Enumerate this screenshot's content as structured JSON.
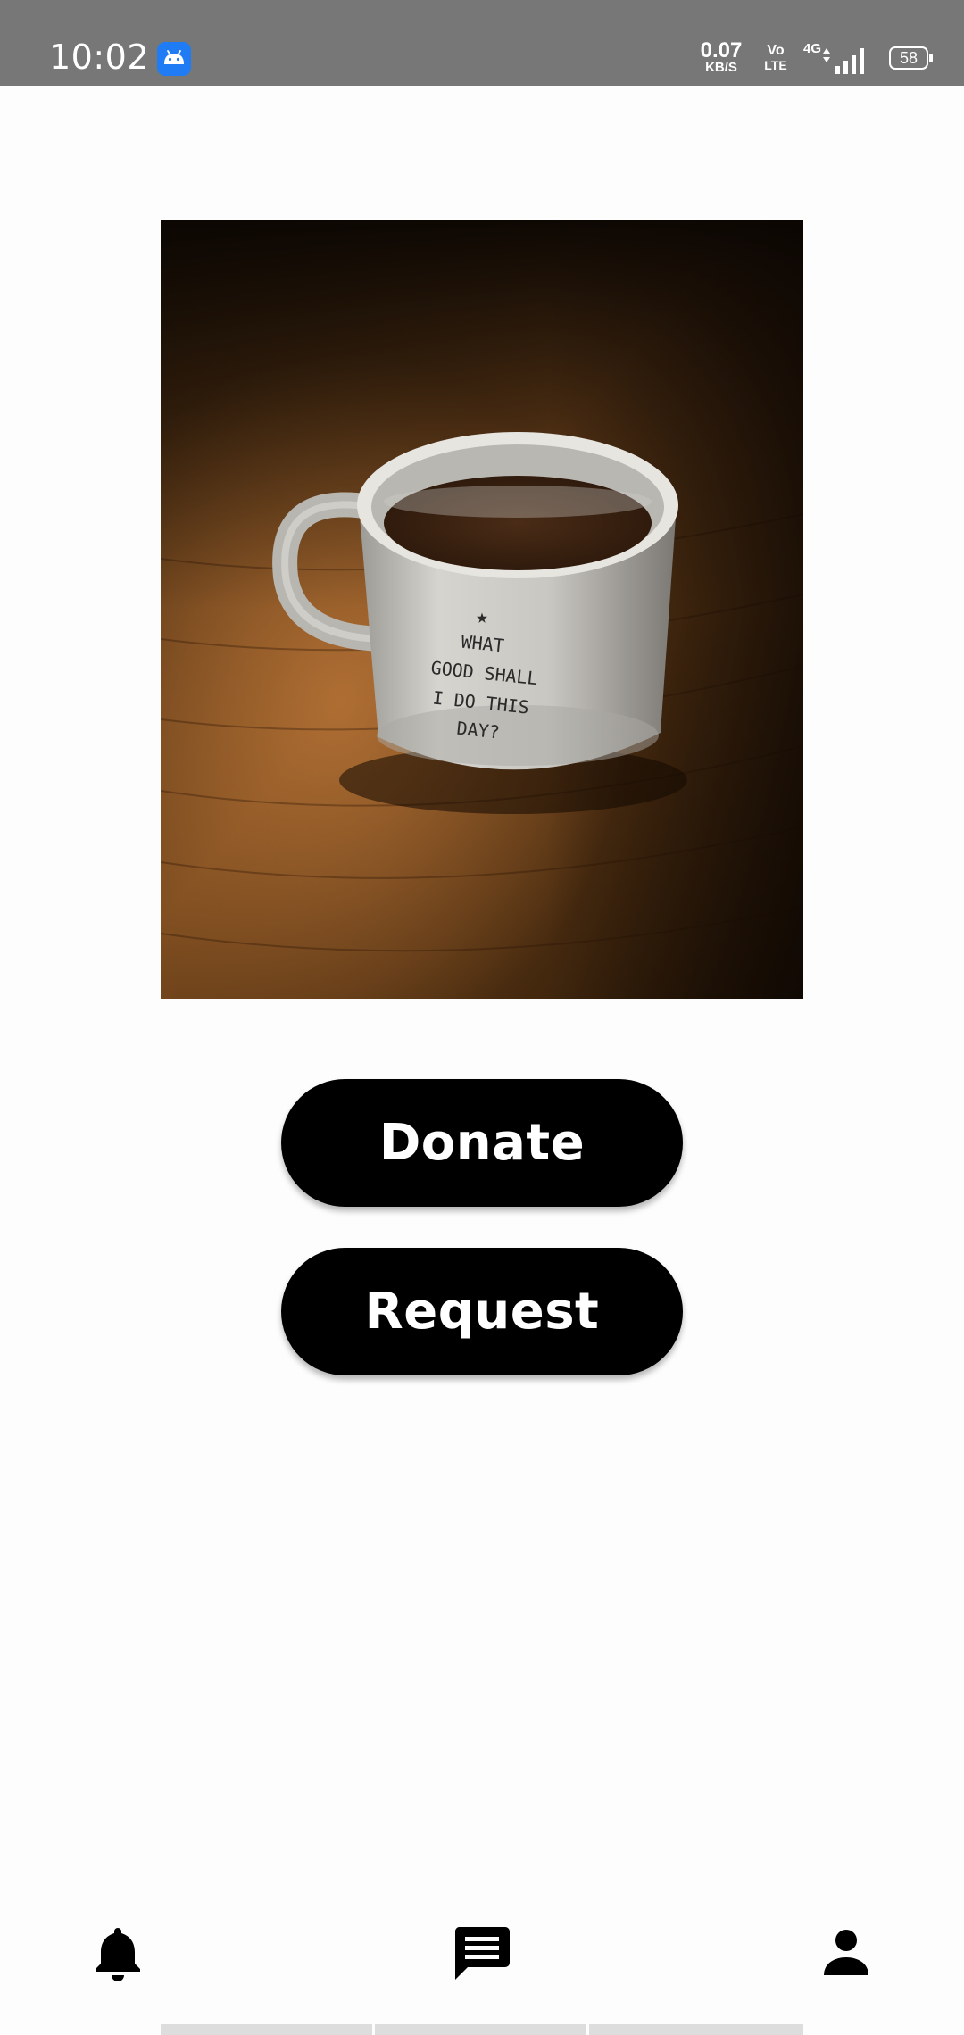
{
  "status_bar": {
    "time": "10:02",
    "app_icon": "android-icon",
    "net_speed_value": "0.07",
    "net_speed_unit": "KB/S",
    "volte_top": "Vo",
    "volte_bottom": "LTE",
    "network_type": "4G",
    "battery_level": "58"
  },
  "hero": {
    "image": "coffee-mug-photo",
    "mug_lines": [
      "WHAT",
      "GOOD SHALL",
      "I DO THIS",
      "DAY?"
    ]
  },
  "actions": {
    "donate_label": "Donate",
    "request_label": "Request"
  },
  "bottom_nav": {
    "items": [
      {
        "icon": "bell-icon"
      },
      {
        "icon": "chat-icon"
      },
      {
        "icon": "person-icon"
      }
    ]
  },
  "colors": {
    "status_bar": "#777777",
    "background": "#fdfdfd",
    "button": "#000000",
    "button_text": "#ffffff",
    "android_badge": "#1f7cf4"
  }
}
